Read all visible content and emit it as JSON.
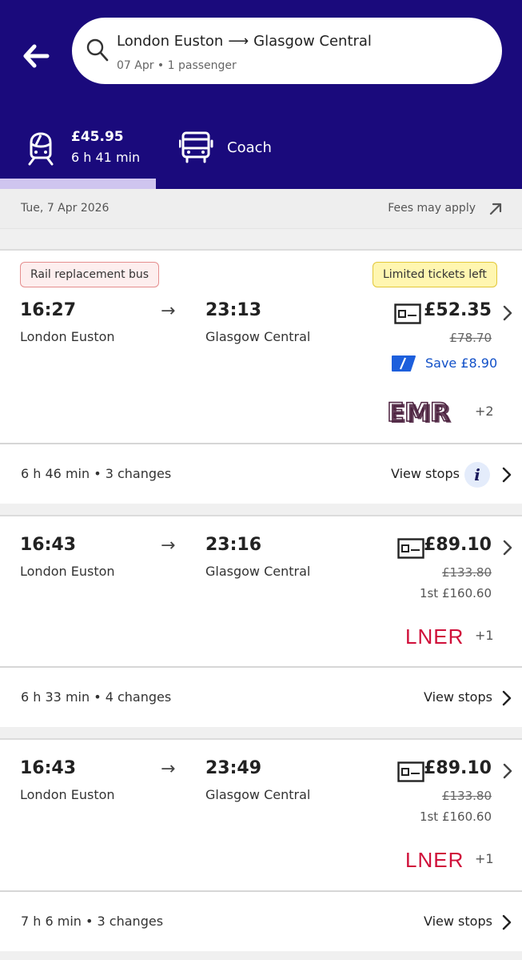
{
  "header": {
    "origin": "London Euston",
    "destination": "Glasgow Central",
    "route_arrow": "⟶",
    "meta": "07 Apr • 1 passenger"
  },
  "tabs": {
    "train": {
      "price": "£45.95",
      "duration": "6 h 41 min",
      "selected": true
    },
    "coach": {
      "label": "Coach"
    }
  },
  "date_bar": {
    "date": "Tue, 7 Apr 2026",
    "fees": "Fees may apply"
  },
  "journeys": [
    {
      "badge_left": "Rail replacement bus",
      "badge_right": "Limited tickets left",
      "depart_time": "16:27",
      "depart_station": "London Euston",
      "arrive_time": "23:13",
      "arrive_station": "Glasgow Central",
      "price": "£52.35",
      "old_price": "£78.70",
      "save": "Save £8.90",
      "operator": "EMR",
      "operator_extra": "+2",
      "summary": "6 h 46 min • 3 changes",
      "view_stops": "View stops"
    },
    {
      "depart_time": "16:43",
      "depart_station": "London Euston",
      "arrive_time": "23:16",
      "arrive_station": "Glasgow Central",
      "price": "£89.10",
      "old_price": "£133.80",
      "first_class": "1st £160.60",
      "operator": "LNER",
      "operator_extra": "+1",
      "summary": "6 h 33 min • 4 changes",
      "view_stops": "View stops"
    },
    {
      "depart_time": "16:43",
      "depart_station": "London Euston",
      "arrive_time": "23:49",
      "arrive_station": "Glasgow Central",
      "price": "£89.10",
      "old_price": "£133.80",
      "first_class": "1st £160.60",
      "operator": "LNER",
      "operator_extra": "+1",
      "summary": "7 h 6 min • 3 changes",
      "view_stops": "View stops"
    }
  ],
  "arrow_glyph": "→",
  "colors": {
    "header_bg": "#1a0a7c",
    "tab_indicator": "#cfc5ef",
    "save_blue": "#1150c8",
    "lner_red": "#d0103a",
    "emr_plum": "#4a1f3d"
  }
}
